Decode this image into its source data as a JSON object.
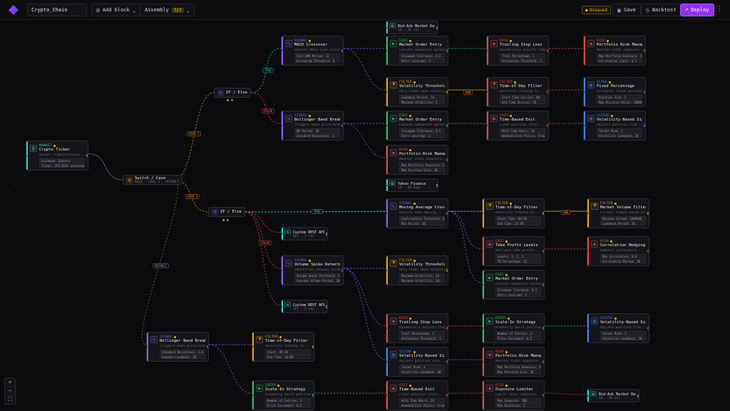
{
  "app": {
    "strategy_name": "Crypto_Chain",
    "add_block_label": "Add block",
    "assembly_label": "Assembly",
    "assembly_count": "7/7",
    "unsaved_label": "Unsaved",
    "save_label": "Save",
    "backtest_label": "Backtest",
    "deploy_label": "Deploy"
  },
  "colors": {
    "accent": "#9333ea",
    "warning": "#eab308",
    "cyan": "#2dd4bf",
    "purple": "#8b5cf6",
    "orange": "#f59e0b",
    "red": "#ef4444",
    "green": "#22c55e",
    "blue": "#3b82f6"
  },
  "controls": {
    "switch": {
      "title": "Switch / Case",
      "sub": "RULE · CASE 3 · DEFAULT"
    },
    "ifelse1": {
      "title": "IF / Else"
    },
    "ifelse2": {
      "title": "IF / Else"
    }
  },
  "edge_labels": {
    "true1": "TRUE",
    "false1": "FALSE",
    "case1": "CASE 1",
    "case2": "CASE 2",
    "default": "DEFAULT",
    "true2": "TRUE",
    "false2": "FALSE",
    "and1": "AND",
    "and2": "AND"
  },
  "nodes": [
    {
      "id": "crypto",
      "cat": "MARKET",
      "title": "Crypto Ticker",
      "desc": "Select cryptocurrency...",
      "params": [
        "Exchange: Binance",
        "Ticker: BTC/USDT perpetual"
      ],
      "color": "cyan",
      "icon": "ticker-icon"
    },
    {
      "id": "macd",
      "cat": "SIGNAL",
      "title": "MACD Crossover",
      "desc": "Detects MACD line crossing...",
      "params": [
        "Fast EMA Period: 12",
        "Histogram Threshold: 0"
      ],
      "color": "purple",
      "icon": "signal-icon"
    },
    {
      "id": "bb1",
      "cat": "SIGNAL",
      "title": "Bollinger Band Breakout",
      "desc": "Triggers when price breaks...",
      "params": [
        "BB Period: 20",
        "Standard Deviations: 2"
      ],
      "color": "purple",
      "icon": "signal-icon"
    },
    {
      "id": "bidask",
      "cat": "DATA",
      "title": "Bid-Ask Market Data",
      "desc": "1m · 30 sec",
      "params": [],
      "color": "cyan",
      "icon": "data-icon",
      "small": true
    },
    {
      "id": "mop1",
      "cat": "EXEC",
      "title": "Market Order Entry",
      "desc": "Execute immediate market...",
      "params": [
        "Slippage Tolerance: 0.5",
        "Entry Leverage: 3"
      ],
      "color": "green",
      "icon": "exec-icon"
    },
    {
      "id": "tsl1",
      "cat": "RISK",
      "title": "Trailing Stop Loss",
      "desc": "Dynamically adjusts stop...",
      "params": [
        "Trail Percentage: 2",
        "Activation Threshold: 1"
      ],
      "color": "red",
      "icon": "risk-icon"
    },
    {
      "id": "prm1",
      "cat": "RISK",
      "title": "Portfolio Risk Manager",
      "desc": "Monitor total exposure...",
      "params": [
        "Max Portfolio Exposure: 50",
        "Correlation Limit: 0.7"
      ],
      "color": "red",
      "icon": "risk-icon"
    },
    {
      "id": "vt1",
      "cat": "FILTER",
      "title": "Volatility Threshold",
      "desc": "Only trade when volatility...",
      "params": [
        "Lookback Period: 14",
        "Maximum Volatility: 5"
      ],
      "color": "orange",
      "icon": "filter-icon"
    },
    {
      "id": "tod1",
      "cat": "FILTER",
      "title": "Time-of-Day Filter",
      "desc": "Restricts trading to...",
      "params": [
        "Start Time Session: 09",
        "End Time Session: 16"
      ],
      "color": "red",
      "icon": "filter-icon"
    },
    {
      "id": "fund1",
      "cat": "ALPHA",
      "title": "Fixed Percentage",
      "desc": "Allocates fixed percentage...",
      "params": [
        "Position Size: 5",
        "Max Position Value: 10000"
      ],
      "color": "blue",
      "icon": "sizing-icon"
    },
    {
      "id": "mop2",
      "cat": "EXEC",
      "title": "Market Order Entry",
      "desc": "Execute immediate market...",
      "params": [
        "Slippage Tolerance: 0.5",
        "Entry Leverage: 3"
      ],
      "color": "green",
      "icon": "exec-icon"
    },
    {
      "id": "tbe1",
      "cat": "EXIT",
      "title": "Time-Based Exit",
      "desc": "Close position after...",
      "params": [
        "Hold Time Hours: 24",
        "Weekend Exit Policy: true"
      ],
      "color": "red",
      "icon": "exit-icon"
    },
    {
      "id": "vbs1",
      "cat": "SIZING",
      "title": "Volatility-Based Sizing",
      "desc": "Adjusts position size...",
      "params": [
        "Target Risk: 2",
        "Volatility Lookback: 20"
      ],
      "color": "blue",
      "icon": "sizing-icon"
    },
    {
      "id": "prm2",
      "cat": "RISK",
      "title": "Portfolio Risk Manager",
      "desc": "Monitor total exposure...",
      "params": [
        "Max Portfolio Exposure: 50",
        "Max Position Size: 10"
      ],
      "color": "red",
      "icon": "risk-icon"
    },
    {
      "id": "yahoo",
      "cat": "DATA",
      "title": "Yahoo Finance",
      "desc": "1d · 30 days",
      "params": [],
      "color": "cyan",
      "icon": "data-icon",
      "small": true
    },
    {
      "id": "mac1",
      "cat": "SIGNAL",
      "title": "Moving Average Crossover",
      "desc": "Detects when moving...",
      "params": [
        "Confirmation Threshold: 0.5",
        "Min Period: 10"
      ],
      "color": "purple",
      "icon": "signal-icon"
    },
    {
      "id": "tod2",
      "cat": "FILTER",
      "title": "Time-of-Day Filter",
      "desc": "Restricts trading to...",
      "params": [
        "Start Time: 09:30",
        "End Time: 15:30"
      ],
      "color": "orange",
      "icon": "filter-icon"
    },
    {
      "id": "mvf1",
      "cat": "FILTER",
      "title": "Market Volume Filter",
      "desc": "Filters trades based on...",
      "params": [
        "Minimum Volume: 1000000",
        "Lookback Period: 20"
      ],
      "color": "orange",
      "icon": "filter-icon"
    },
    {
      "id": "rest1",
      "cat": "API",
      "title": "Custom REST API",
      "desc": "GET · 5 sec",
      "params": [],
      "color": "cyan",
      "icon": "api-icon",
      "small": true
    },
    {
      "id": "tpl1",
      "cat": "EXIT",
      "title": "Take Profit Levels",
      "desc": "Multiple take profit...",
      "params": [
        "Levels: 1, 2, 3",
        "TP Percentage: 33"
      ],
      "color": "red",
      "icon": "exit-icon"
    },
    {
      "id": "cb1",
      "cat": "RISK",
      "title": "Correlation Hedging",
      "desc": "Reduces correlation...",
      "params": [
        "Max Correlation: 0.8",
        "Correlation Period: 30"
      ],
      "color": "red",
      "icon": "risk-icon"
    },
    {
      "id": "vsd1",
      "cat": "SIGNAL",
      "title": "Volume Spike Detector",
      "desc": "Identifies unusual volume...",
      "params": [
        "Volume Spike Threshold: 2",
        "Average Volume Period: 20"
      ],
      "color": "purple",
      "icon": "signal-icon"
    },
    {
      "id": "vt2",
      "cat": "FILTER",
      "title": "Volatility Threshold",
      "desc": "Only trade when volatility...",
      "params": [
        "Maximum Volatility: 14",
        "Maximum Volatility: 50"
      ],
      "color": "orange",
      "icon": "filter-icon"
    },
    {
      "id": "mso1",
      "cat": "EXEC",
      "title": "Market Order Entry",
      "desc": "Execute immediate market...",
      "params": [
        "Slippage Tolerance: 0.5",
        "Entry Leverage: 3"
      ],
      "color": "green",
      "icon": "exec-icon"
    },
    {
      "id": "rest2",
      "cat": "API",
      "title": "Custom REST API",
      "desc": "GET · 5 sec",
      "params": [],
      "color": "cyan",
      "icon": "api-icon",
      "small": true
    },
    {
      "id": "tsl2",
      "cat": "RISK",
      "title": "Trailing Stop Loss",
      "desc": "Dynamically adjusts stop...",
      "params": [
        "Trail Percentage: 2",
        "Activation Threshold: 1"
      ],
      "color": "red",
      "icon": "risk-icon"
    },
    {
      "id": "sib1",
      "cat": "ENTRY",
      "title": "Scale-In Strategy",
      "desc": "Gradually build position...",
      "params": [
        "Number of Entries: 3",
        "Price Increment: 0.5"
      ],
      "color": "green",
      "icon": "exec-icon"
    },
    {
      "id": "vbs2",
      "cat": "SIZING",
      "title": "Volatility-Based Sizing",
      "desc": "Adjusts position size...",
      "params": [
        "Target Risk: 2",
        "Volatility Lookback: 20"
      ],
      "color": "blue",
      "icon": "sizing-icon"
    },
    {
      "id": "bb2",
      "cat": "SIGNAL",
      "title": "Bollinger Band Breakout",
      "desc": "Triggers when price breaks...",
      "params": [
        "Standard Deviations: 2.0",
        "Squeeze Lookback: 20"
      ],
      "color": "purple",
      "icon": "signal-icon"
    },
    {
      "id": "tod3",
      "cat": "FILTER",
      "title": "Time-of-Day Filter",
      "desc": "Restricts trading to...",
      "params": [
        "Start: 09:30",
        "End Time: 16:00"
      ],
      "color": "orange",
      "icon": "filter-icon"
    },
    {
      "id": "vbs3",
      "cat": "SIZING",
      "title": "Volatility-Based Sizing",
      "desc": "Adjusts position size...",
      "params": [
        "Target Risk: 2",
        "Volatility Lookback: 20"
      ],
      "color": "blue",
      "icon": "sizing-icon"
    },
    {
      "id": "prm3",
      "cat": "RISK",
      "title": "Portfolio Risk Manager",
      "desc": "Monitor total exposure...",
      "params": [
        "Max Portfolio Exposure: 50",
        "Max Position Size: 10"
      ],
      "color": "red",
      "icon": "risk-icon"
    },
    {
      "id": "sis2",
      "cat": "ENTRY",
      "title": "Scale-In Strategy",
      "desc": "Gradually build position...",
      "params": [
        "Number of Entries: 3",
        "Price Increment: 0.5"
      ],
      "color": "green",
      "icon": "exec-icon"
    },
    {
      "id": "tbe2",
      "cat": "EXIT",
      "title": "Time-Based Exit",
      "desc": "Close position after...",
      "params": [
        "Hold Time Hours: 24",
        "Weekend Exit Policy: true"
      ],
      "color": "red",
      "icon": "exit-icon"
    },
    {
      "id": "exp1",
      "cat": "RISK",
      "title": "Exposure Limiter",
      "desc": "Limits total exposure...",
      "params": [
        "Max Exposure: 100",
        "Max Positions: 5"
      ],
      "color": "red",
      "icon": "risk-icon"
    },
    {
      "id": "bidask2",
      "cat": "DATA",
      "title": "Bid-Ask Market Data",
      "desc": "1m · 30 sec",
      "params": [],
      "color": "cyan",
      "icon": "data-icon",
      "small": true
    }
  ]
}
